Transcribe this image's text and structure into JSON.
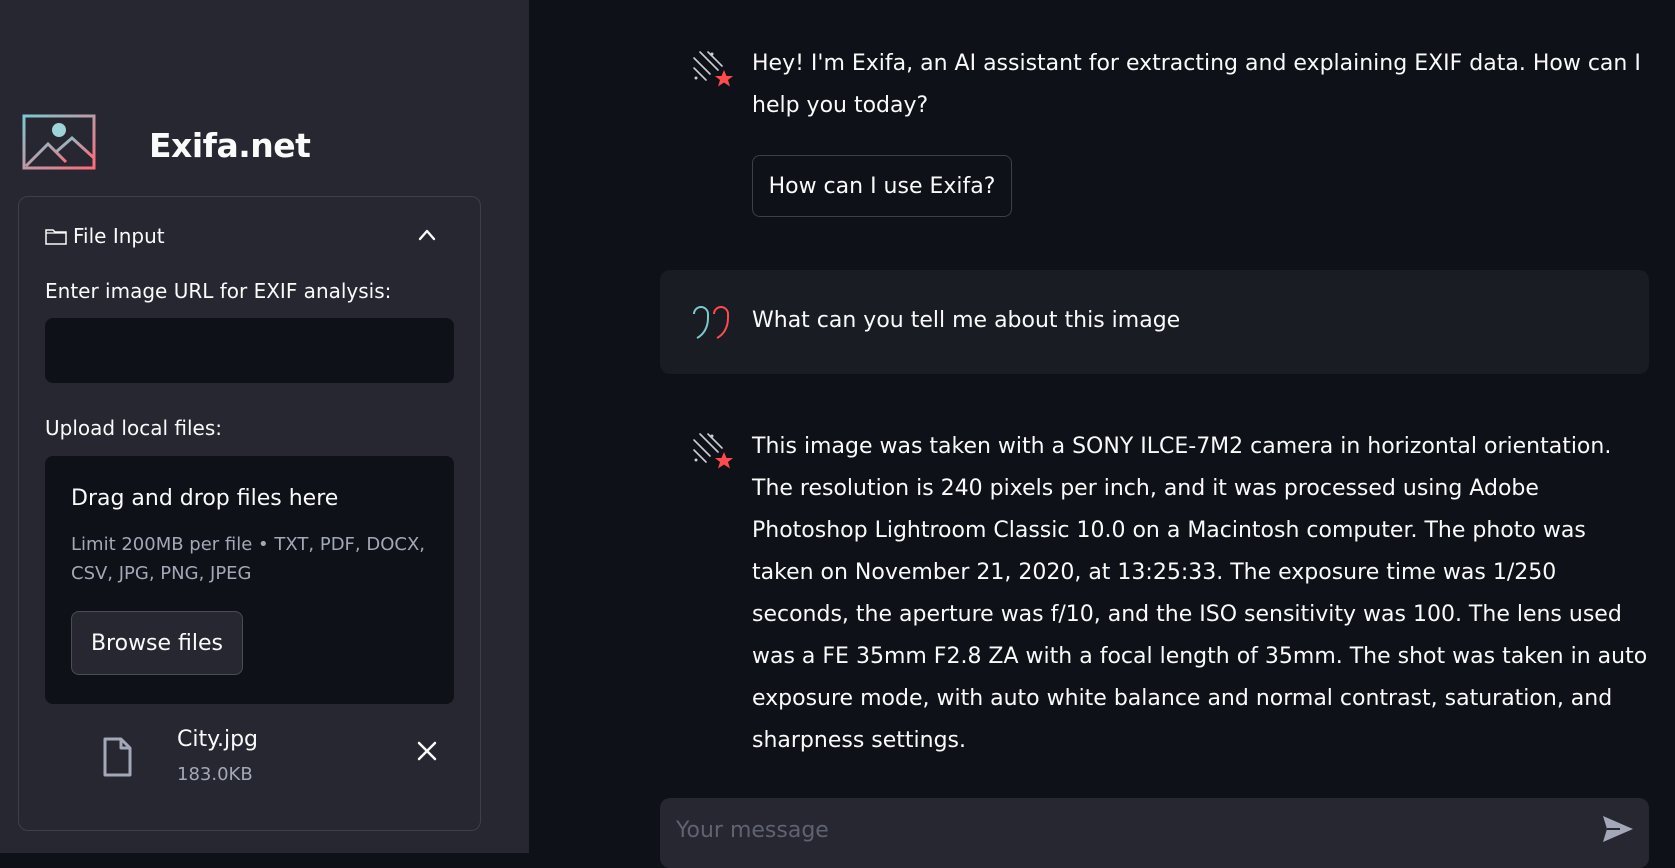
{
  "sidebar": {
    "brand_title": "Exifa.net",
    "expander": {
      "icon": "folder-icon",
      "title": "File Input"
    },
    "url_label": "Enter image URL for EXIF analysis:",
    "url_value": "",
    "upload_label": "Upload local files:",
    "dropzone": {
      "title": "Drag and drop files here",
      "limit": "Limit 200MB per file • TXT, PDF, DOCX, CSV, JPG, PNG, JPEG",
      "browse_label": "Browse files"
    },
    "uploaded_file": {
      "name": "City.jpg",
      "size": "183.0KB"
    }
  },
  "chat": {
    "messages": [
      {
        "role": "assistant",
        "text": "Hey! I'm Exifa, an AI assistant for extracting and explaining EXIF data. How can I help you today?"
      },
      {
        "role": "user",
        "text": "What can you tell me about this image"
      },
      {
        "role": "assistant",
        "text": "This image was taken with a SONY ILCE-7M2 camera in horizontal orientation. The resolution is 240 pixels per inch, and it was processed using Adobe Photoshop Lightroom Classic 10.0 on a Macintosh computer. The photo was taken on November 21, 2020, at 13:25:33. The exposure time was 1/250 seconds, the aperture was f/10, and the ISO sensitivity was 100. The lens used was a FE 35mm F2.8 ZA with a focal length of 35mm. The shot was taken in auto exposure mode, with auto white balance and normal contrast, saturation, and sharpness settings."
      }
    ],
    "suggestion": "How can I use Exifa?",
    "input_placeholder": "Your message",
    "input_value": ""
  },
  "colors": {
    "sidebar_bg": "#262730",
    "main_bg": "#0e1117",
    "accent_red": "#ff4b4b",
    "accent_teal": "#7ec8d0"
  }
}
